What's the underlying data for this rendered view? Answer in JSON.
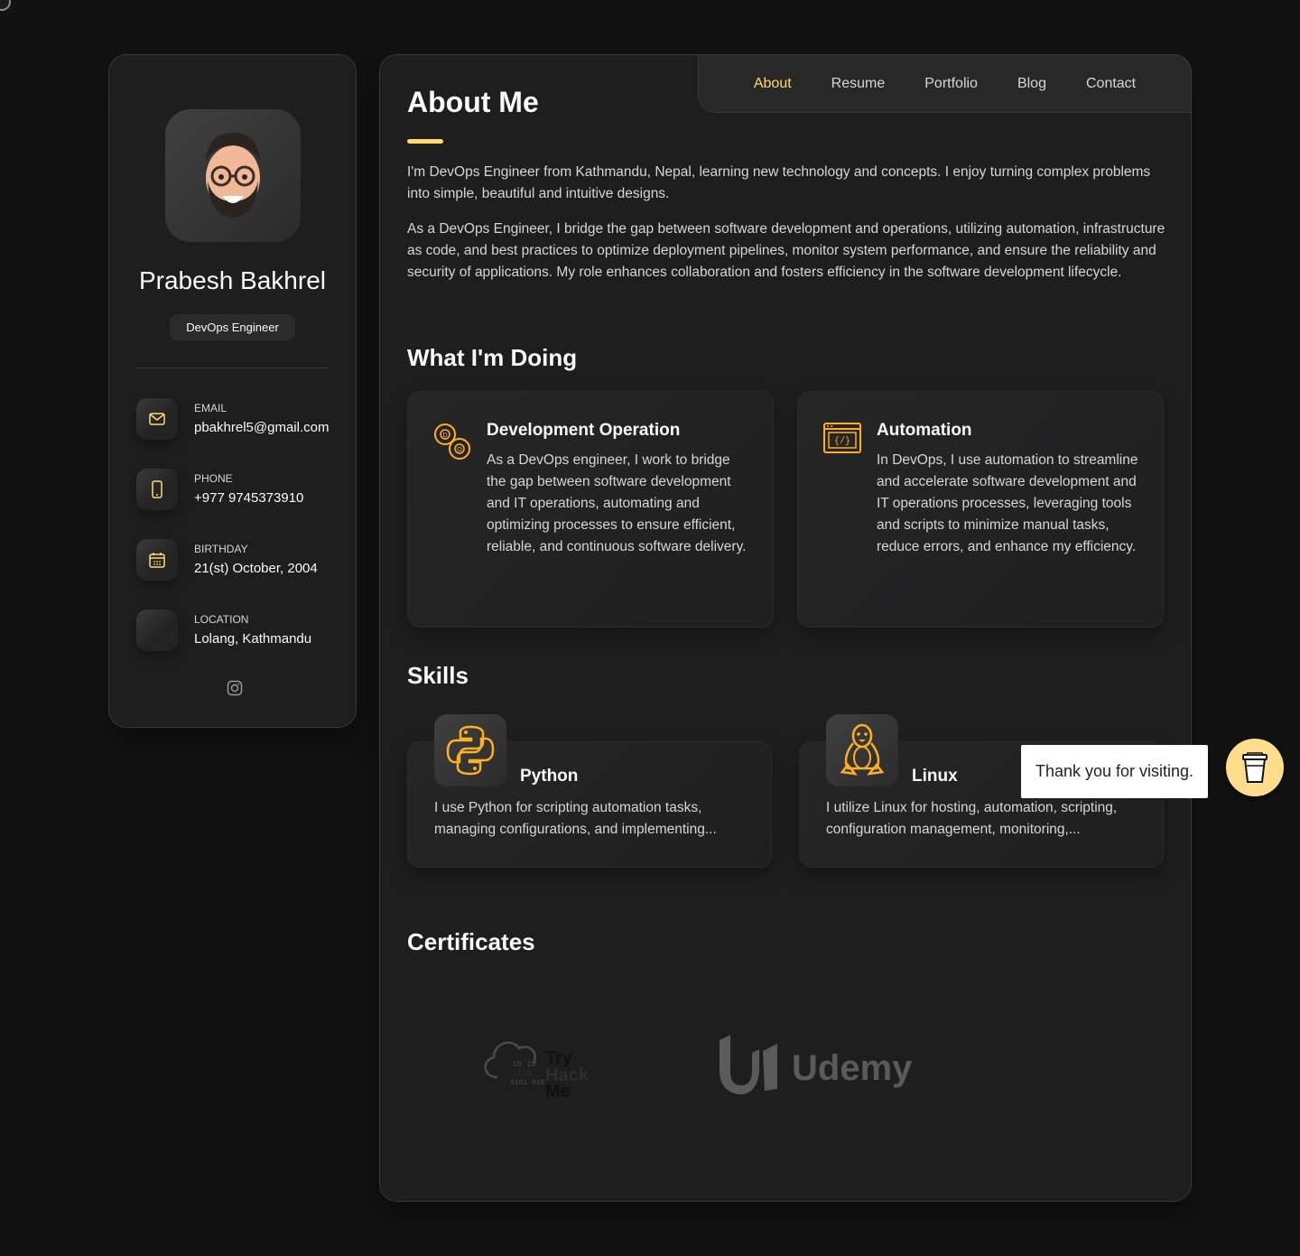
{
  "profile": {
    "name": "Prabesh Bakhrel",
    "title": "DevOps Engineer"
  },
  "contacts": [
    {
      "label": "Email",
      "value": "pbakhrel5@gmail.com",
      "icon": "mail-icon"
    },
    {
      "label": "Phone",
      "value": "+977 9745373910",
      "icon": "phone-icon"
    },
    {
      "label": "Birthday",
      "value": "21(st) October, 2004",
      "icon": "calendar-icon"
    },
    {
      "label": "Location",
      "value": "Lolang, Kathmandu",
      "icon": "location-icon"
    }
  ],
  "nav": {
    "items": [
      "About",
      "Resume",
      "Portfolio",
      "Blog",
      "Contact"
    ],
    "active": "About"
  },
  "about": {
    "title": "About Me",
    "paragraphs": [
      "I'm DevOps Engineer from Kathmandu, Nepal, learning new technology and concepts. I enjoy turning complex problems into simple, beautiful and intuitive designs.",
      "As a DevOps Engineer, I bridge the gap between software development and operations, utilizing automation, infrastructure as code, and best practices to optimize deployment pipelines, monitor system performance, and ensure the reliability and security of applications. My role enhances collaboration and fosters efficiency in the software development lifecycle."
    ]
  },
  "services": {
    "title": "What I'm Doing",
    "items": [
      {
        "title": "Development Operation",
        "text": "As a DevOps engineer, I work to bridge the gap between software development and IT operations, automating and optimizing processes to ensure efficient, reliable, and continuous software delivery.",
        "icon": "devops-infinity-icon"
      },
      {
        "title": "Automation",
        "text": "In DevOps, I use automation to streamline and accelerate software development and IT operations processes, leveraging tools and scripts to minimize manual tasks, reduce errors, and enhance my efficiency.",
        "icon": "code-window-icon"
      }
    ]
  },
  "skills": {
    "title": "Skills",
    "items": [
      {
        "title": "Python",
        "text": "I use Python for scripting automation tasks, managing configurations, and implementing...",
        "icon": "python-icon"
      },
      {
        "title": "Linux",
        "text": "I utilize Linux for hosting, automation, scripting, configuration management, monitoring,...",
        "icon": "linux-tux-icon"
      }
    ]
  },
  "certificates": {
    "title": "Certificates",
    "items": [
      {
        "name": "Try Hack Me",
        "icon": "tryhackme-logo"
      },
      {
        "name": "Udemy",
        "icon": "udemy-logo"
      }
    ]
  },
  "tooltip": {
    "text": "Thank you for visiting."
  },
  "colors": {
    "accent": "#ffdb70",
    "background": "#121212",
    "panel": "#1e1e1f",
    "coffee": "#ffdd8a"
  }
}
